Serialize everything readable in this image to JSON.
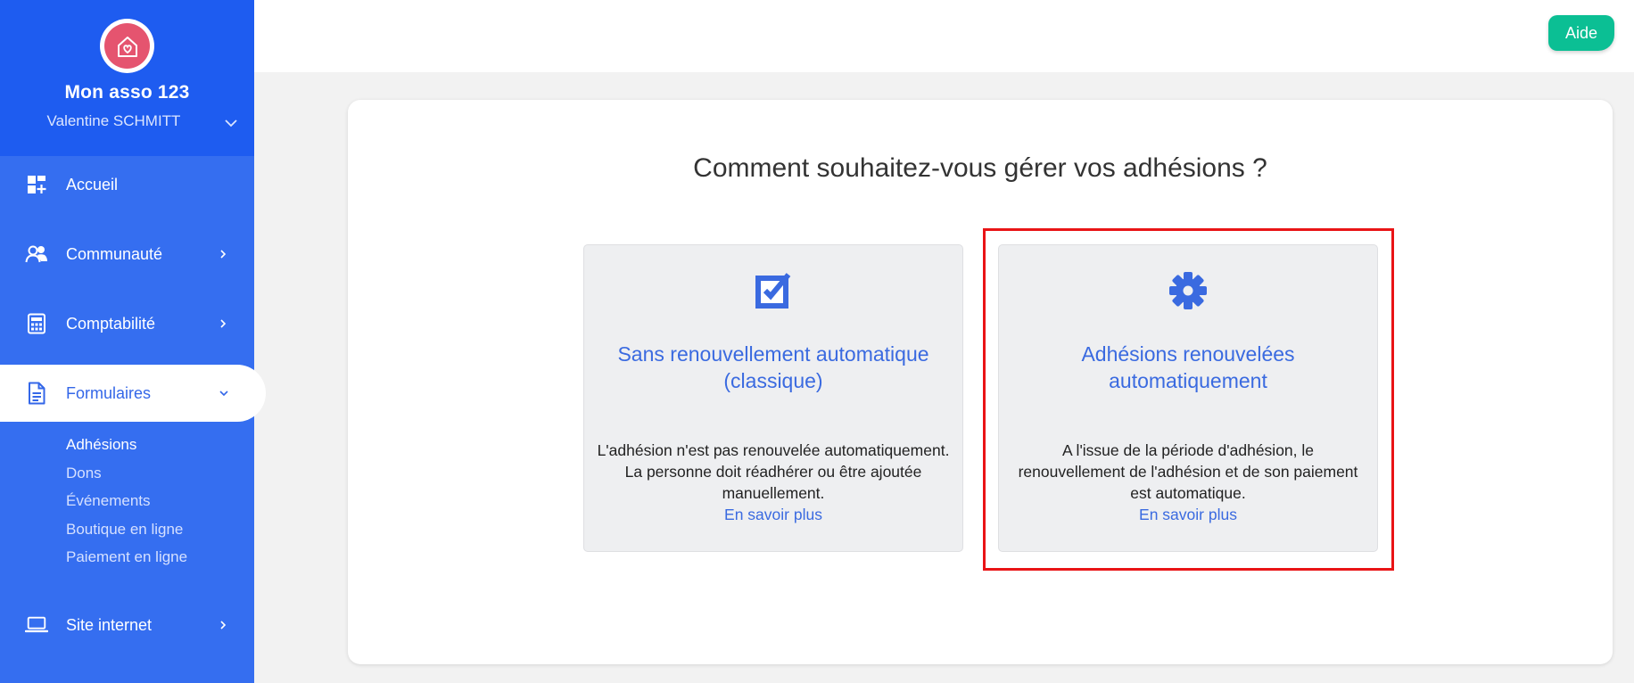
{
  "sidebar": {
    "org_name": "Mon asso 123",
    "user_name": "Valentine SCHMITT",
    "nav": {
      "home": "Accueil",
      "community": "Communauté",
      "accounting": "Comptabilité",
      "forms": "Formulaires",
      "website": "Site internet"
    },
    "subnav": [
      "Adhésions",
      "Dons",
      "Événements",
      "Boutique en ligne",
      "Paiement en ligne"
    ]
  },
  "topbar": {
    "help_label": "Aide"
  },
  "main": {
    "question": "Comment souhaitez-vous gérer vos adhésions ?",
    "options": [
      {
        "title": "Sans renouvellement automatique (classique)",
        "description": "L'adhésion n'est pas renouvelée automatiquement. La personne doit réadhérer ou être ajoutée manuellement.",
        "link": "En savoir plus",
        "icon": "edit-checkbox-icon"
      },
      {
        "title": "Adhésions renouvelées automatiquement",
        "description": "A l'issue de la période d'adhésion, le renouvellement de l'adhésion et de son paiement est automatique.",
        "link": "En savoir plus",
        "icon": "gear-icon"
      }
    ]
  },
  "colors": {
    "sidebar_bg": "#356ef0",
    "sidebar_header_bg": "#1e5cf0",
    "accent_blue": "#3a6ae0",
    "help_green": "#0bbf94",
    "logo_pink": "#e5546f",
    "highlight_red": "#e91416"
  }
}
